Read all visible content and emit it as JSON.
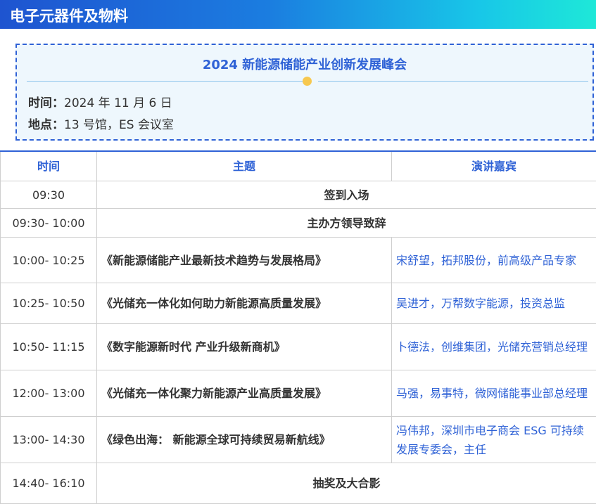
{
  "section_title": "电子元器件及物料",
  "event": {
    "title": "2024 新能源储能产业创新发展峰会",
    "time_label": "时间：",
    "time_value": "2024 年 11 月 6 日",
    "place_label": "地点：",
    "place_value": "13 号馆，ES 会议室"
  },
  "table": {
    "headers": [
      "时间",
      "主题",
      "演讲嘉宾"
    ],
    "rows": [
      {
        "time": "09:30",
        "topic": "签到入场",
        "speaker": ""
      },
      {
        "time": "09:30- 10:00",
        "topic": "主办方领导致辞",
        "speaker": ""
      },
      {
        "time": "10:00- 10:25",
        "topic": "《新能源储能产业最新技术趋势与发展格局》",
        "speaker": "宋舒望，拓邦股份，前高级产品专家"
      },
      {
        "time": "10:25- 10:50",
        "topic": "《光储充一体化如何助力新能源高质量发展》",
        "speaker": "吴进才，万帮数字能源，投资总监"
      },
      {
        "time": "10:50- 11:15",
        "topic": "《数字能源新时代 产业升级新商机》",
        "speaker": "卜德法，创维集团，光储充营销总经理"
      },
      {
        "time": "12:00- 13:00",
        "topic": "《光储充一体化聚力新能源产业高质量发展》",
        "speaker": "马强，易事特，微网储能事业部总经理"
      },
      {
        "time": "13:00- 14:30",
        "topic": "《绿色出海： 新能源全球可持续贸易新航线》",
        "speaker": "冯伟邦，深圳市电子商会 ESG 可持续发展专委会，主任"
      },
      {
        "time": "14:40- 16:10",
        "topic": "抽奖及大合影",
        "speaker": ""
      }
    ]
  }
}
